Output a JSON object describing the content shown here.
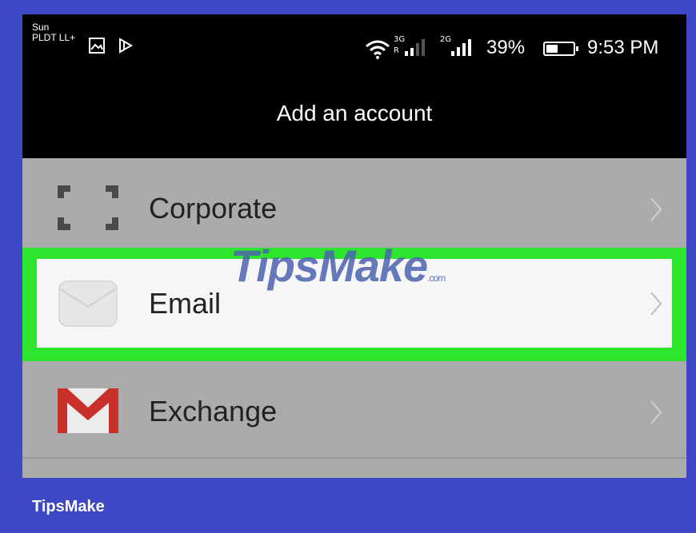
{
  "status_bar": {
    "carrier_line1": "Sun",
    "carrier_line2": "PLDT LL+",
    "net1_top": "3G",
    "net1_bottom": "R",
    "net2_top": "2G",
    "battery_pct": "39%",
    "time": "9:53 PM",
    "icons": [
      "image-icon",
      "notification-icon",
      "wifi-icon",
      "signal-icon",
      "battery-icon"
    ]
  },
  "app_bar": {
    "title": "Add an account"
  },
  "accounts": [
    {
      "label": "Corporate",
      "icon": "corporate-icon"
    },
    {
      "label": "Email",
      "icon": "envelope-icon",
      "highlighted": true
    },
    {
      "label": "Exchange",
      "icon": "gmail-icon"
    }
  ],
  "watermark": {
    "text": "TipsMake",
    "suffix": ".com"
  },
  "footer": {
    "brand": "TipsMake"
  },
  "colors": {
    "frame": "#3f48c4",
    "highlight": "#2ce52c",
    "list_bg": "#ababab"
  }
}
